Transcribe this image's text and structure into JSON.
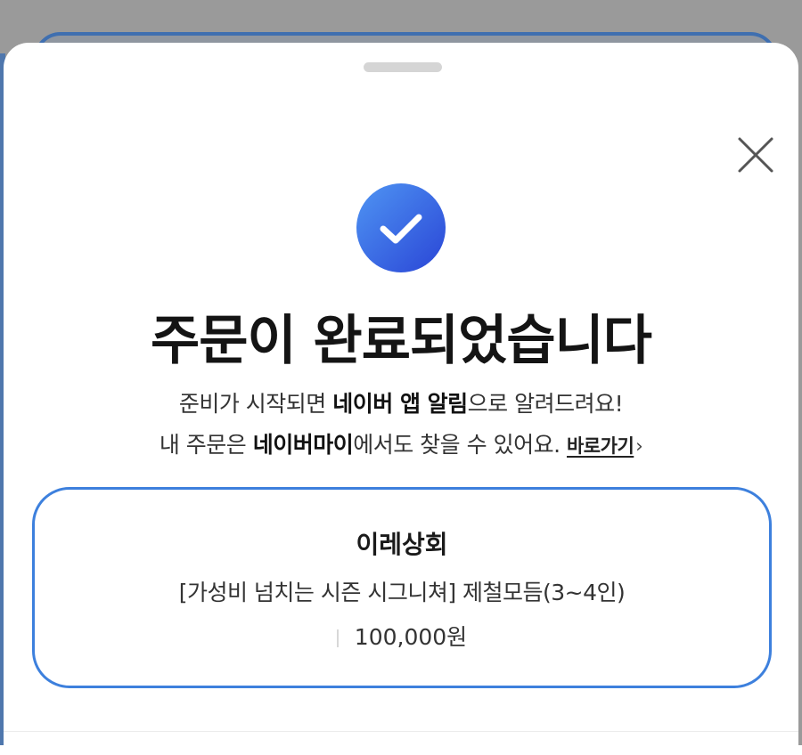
{
  "sheet": {
    "title": "주문이 완료되었습니다",
    "desc_line1": {
      "pre": "준비가 시작되면 ",
      "bold": "네이버 앱 알림",
      "post": "으로 알려드려요!"
    },
    "desc_line2": {
      "pre": "내 주문은 ",
      "bold": "네이버마이",
      "post": "에서도 찾을 수 있어요. ",
      "link": "바로가기",
      "chevron": "›"
    }
  },
  "order": {
    "store": "이레상회",
    "product": "[가성비 넘치는 시즌 시그니쳐] 제철모듬(3~4인)",
    "price": "100,000원"
  },
  "colors": {
    "accent": "#3d80dd",
    "check_top": "#4a8ef0",
    "check_bottom": "#2b4fd8"
  },
  "icons": {
    "close": "close-icon",
    "check": "check-circle-icon"
  }
}
